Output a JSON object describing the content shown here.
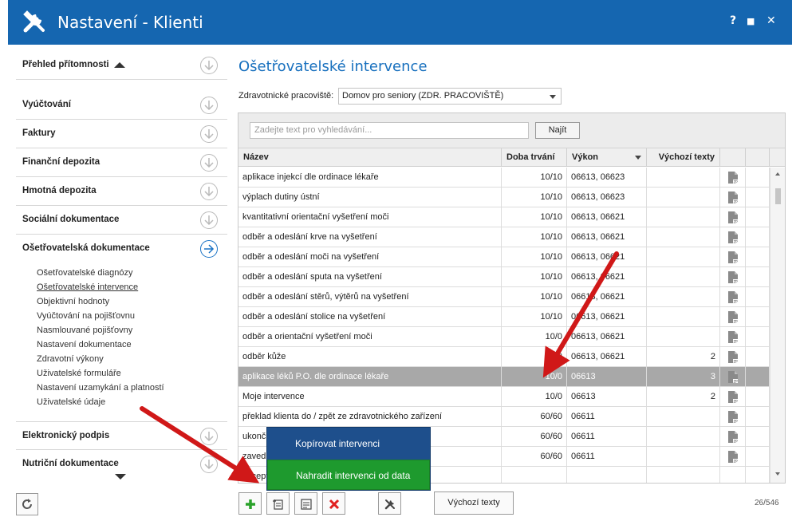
{
  "window": {
    "title": "Nastavení - Klienti",
    "help_label": "?",
    "maximize_label": "■",
    "close_label": "✕"
  },
  "sidebar": {
    "sections": [
      {
        "label": "Přehled přítomnosti"
      },
      {
        "label": "Vyúčtování"
      },
      {
        "label": "Faktury"
      },
      {
        "label": "Finanční depozita"
      },
      {
        "label": "Hmotná depozita"
      },
      {
        "label": "Sociální dokumentace"
      },
      {
        "label": "Ošetřovatelská dokumentace",
        "expanded": true
      },
      {
        "label": "Elektronický podpis"
      },
      {
        "label": "Nutriční dokumentace"
      }
    ],
    "subitems": [
      "Ošetřovatelské diagnózy",
      "Ošetřovatelské intervence",
      "Objektivní hodnoty",
      "Vyúčtování na pojišťovnu",
      "Nasmlouvané pojišťovny",
      "Nastavení dokumentace",
      "Zdravotní výkony",
      "Uživatelské formuláře",
      "Nastavení uzamykání a platností",
      "Uživatelské údaje"
    ],
    "current_subitem": "Ošetřovatelské intervence"
  },
  "main": {
    "title": "Ošetřovatelské intervence",
    "workplace_label": "Zdravotnické pracoviště:",
    "workplace_value": "Domov pro seniory (ZDR. PRACOVIŠTĚ)",
    "search_placeholder": "Zadejte text pro vyhledávání...",
    "search_button": "Najít"
  },
  "table": {
    "columns": [
      "Název",
      "Doba trvání",
      "Výkon",
      "Výchozí texty"
    ],
    "rows": [
      {
        "name": "aplikace injekcí dle ordinace lékaře",
        "duration": "10/10",
        "vykon": "06613, 06623",
        "texts": ""
      },
      {
        "name": "výplach dutiny ústní",
        "duration": "10/10",
        "vykon": "06613, 06623",
        "texts": ""
      },
      {
        "name": "kvantitativní orientační vyšetření moči",
        "duration": "10/10",
        "vykon": "06613, 06621",
        "texts": ""
      },
      {
        "name": "odběr a odeslání krve na vyšetření",
        "duration": "10/10",
        "vykon": "06613, 06621",
        "texts": ""
      },
      {
        "name": "odběr a odeslání moči na vyšetření",
        "duration": "10/10",
        "vykon": "06613, 06621",
        "texts": ""
      },
      {
        "name": "odběr a odeslání sputa na vyšetření",
        "duration": "10/10",
        "vykon": "06613, 06621",
        "texts": ""
      },
      {
        "name": "odběr a odeslání stěrů, výtěrů na vyšetření",
        "duration": "10/10",
        "vykon": "06613, 06621",
        "texts": ""
      },
      {
        "name": "odběr a odeslání stolice na vyšetření",
        "duration": "10/10",
        "vykon": "06613, 06621",
        "texts": ""
      },
      {
        "name": "odběr a orientační vyšetření moči",
        "duration": "10/0",
        "vykon": "06613, 06621",
        "texts": ""
      },
      {
        "name": "odběr kůže",
        "duration": "10/0",
        "vykon": "06613, 06621",
        "texts": "2"
      },
      {
        "name": "aplikace léků P.O. dle ordinace lékaře",
        "duration": "10/0",
        "vykon": "06613",
        "texts": "3",
        "selected": true
      },
      {
        "name": "Moje intervence",
        "duration": "10/0",
        "vykon": "06613",
        "texts": "2"
      },
      {
        "name": "překlad klienta do / zpět ze zdravotnického zařízení",
        "duration": "60/60",
        "vykon": "06611",
        "texts": ""
      },
      {
        "name": "ukonč",
        "duration": "60/60",
        "vykon": "06611",
        "texts": ""
      },
      {
        "name": "zaved",
        "duration": "60/60",
        "vykon": "06611",
        "texts": ""
      },
      {
        "name": "zacept",
        "duration": "",
        "vykon": "",
        "texts": ""
      }
    ]
  },
  "context_menu": {
    "items": [
      "Kopírovat intervenci",
      "Nahradit intervenci od data"
    ]
  },
  "toolbar": {
    "default_texts_button": "Výchozí texty",
    "counter": "26/546"
  },
  "colors": {
    "titlebar": "#1566b0",
    "accent": "#1870be",
    "menu_bg": "#1e4f8c",
    "menu_highlight": "#1e9a2e",
    "selected_row": "#a8a8a8",
    "arrow": "#d01818"
  },
  "icons": [
    "tools-icon",
    "expand-circle-icon",
    "arrow-circle-icon",
    "document-icon",
    "add-icon",
    "copy-edit-icon",
    "edit-icon",
    "delete-icon",
    "wrench-icon",
    "refresh-icon"
  ]
}
